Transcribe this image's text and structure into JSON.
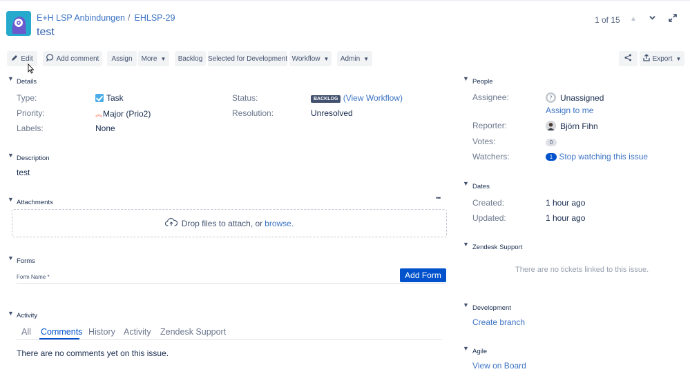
{
  "header": {
    "project": "E+H LSP Anbindungen",
    "separator": "/",
    "issue_key": "EHLSP-29",
    "title": "test",
    "pager": "1 of 15"
  },
  "toolbar": {
    "edit": "Edit",
    "add_comment": "Add comment",
    "assign": "Assign",
    "more": "More",
    "backlog": "Backlog",
    "selected_for_development": "Selected for Development",
    "workflow": "Workflow",
    "admin": "Admin",
    "export": "Export"
  },
  "details": {
    "title": "Details",
    "type_label": "Type:",
    "type_value": "Task",
    "priority_label": "Priority:",
    "priority_value": "Major (Prio2)",
    "labels_label": "Labels:",
    "labels_value": "None",
    "status_label": "Status:",
    "status_value": "BACKLOG",
    "status_link": "(View Workflow)",
    "resolution_label": "Resolution:",
    "resolution_value": "Unresolved"
  },
  "description": {
    "title": "Description",
    "text": "test"
  },
  "attachments": {
    "title": "Attachments",
    "more": "•••",
    "drop_text": "Drop files to attach, or ",
    "browse": "browse."
  },
  "forms": {
    "title": "Forms",
    "form_name_label": "Form Name *",
    "add_form": "Add Form"
  },
  "activity": {
    "title": "Activity",
    "tabs": [
      "All",
      "Comments",
      "History",
      "Activity",
      "Zendesk Support"
    ],
    "active_tab": "Comments",
    "empty": "There are no comments yet on this issue."
  },
  "people": {
    "title": "People",
    "assignee_label": "Assignee:",
    "assignee_value": "Unassigned",
    "assign_to_me": "Assign to me",
    "reporter_label": "Reporter:",
    "reporter_value": "Björn Fihn",
    "votes_label": "Votes:",
    "votes_value": "0",
    "watchers_label": "Watchers:",
    "watchers_value": "1",
    "stop_watching": "Stop watching this issue"
  },
  "dates": {
    "title": "Dates",
    "created_label": "Created:",
    "created_value": "1 hour ago",
    "updated_label": "Updated:",
    "updated_value": "1 hour ago"
  },
  "zendesk": {
    "title": "Zendesk Support",
    "empty": "There are no tickets linked to this issue."
  },
  "development": {
    "title": "Development",
    "create_branch": "Create branch"
  },
  "agile": {
    "title": "Agile",
    "view_on_board": "View on Board"
  },
  "colors": {
    "link": "#3b73c4",
    "primary": "#0052cc",
    "status": "#42526e",
    "priority": "#ff7452"
  }
}
